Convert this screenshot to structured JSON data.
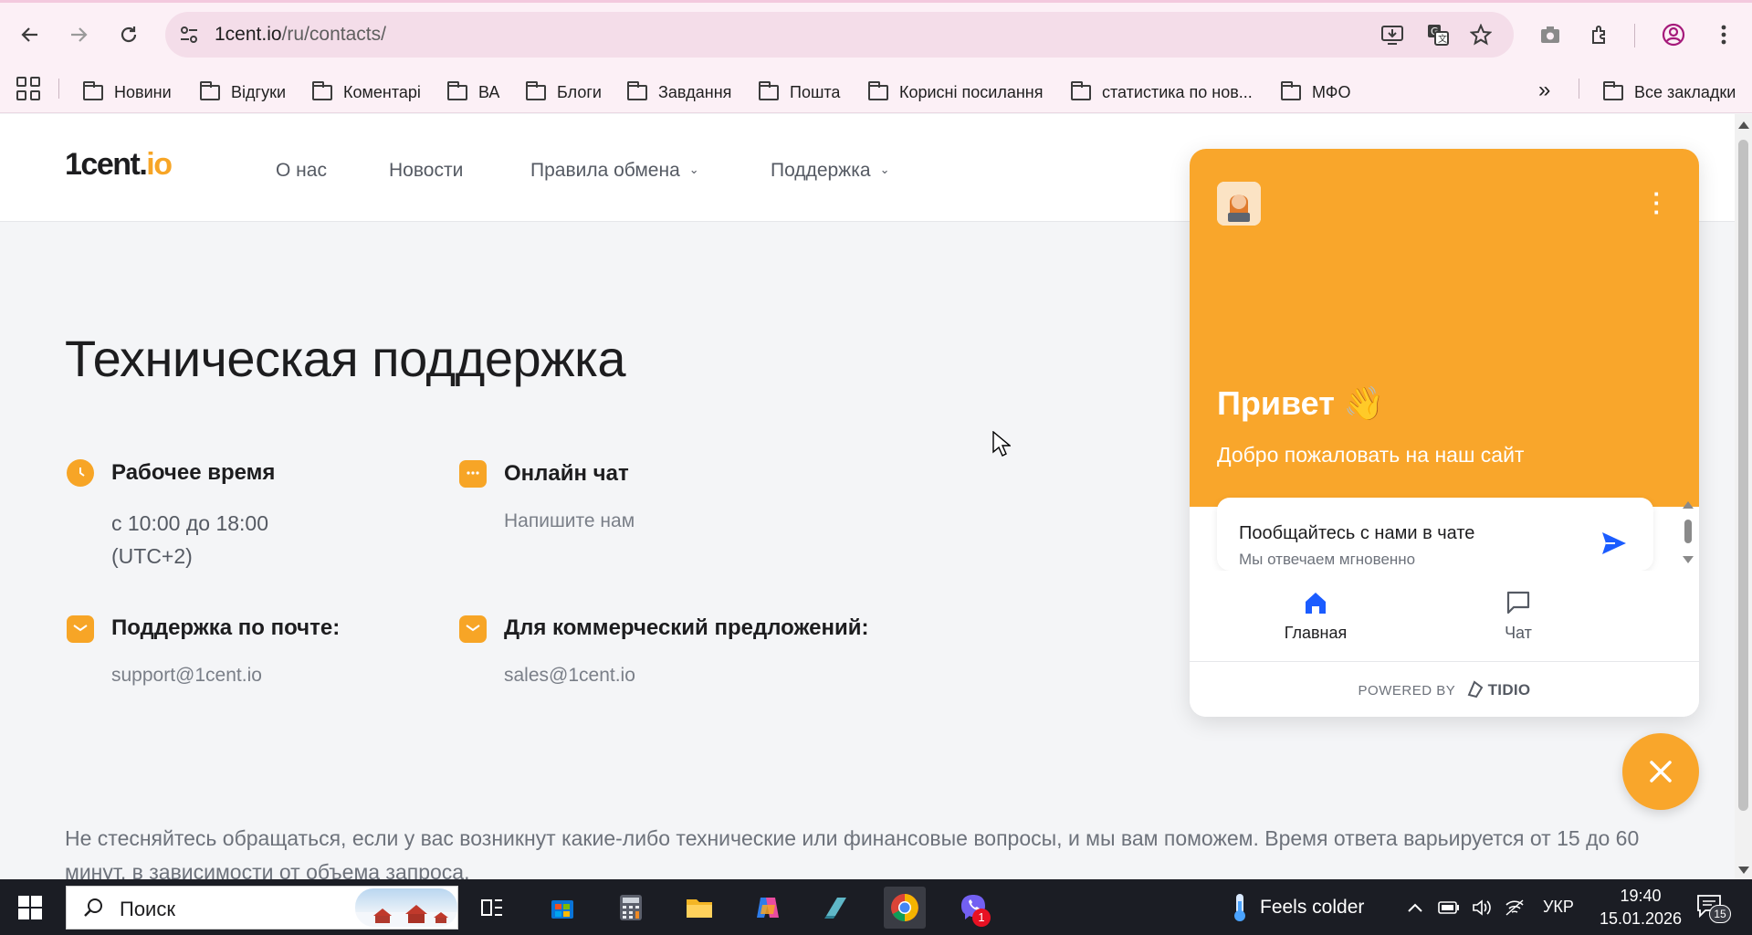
{
  "browser": {
    "url_domain": "1cent.io",
    "url_path": "/ru/contacts/",
    "bookmarks": [
      "Новини",
      "Відгуки",
      "Коментарі",
      "ВА",
      "Блоги",
      "Завдання",
      "Пошта",
      "Корисні посилання",
      "статистика по нов...",
      "МФО"
    ],
    "all_bookmarks": "Все закладки",
    "more_bookmarks_glyph": "»"
  },
  "site": {
    "logo_main": "1cent.",
    "logo_accent": "io",
    "nav": {
      "about": "О нас",
      "news": "Новости",
      "exchange_rules": "Правила обмена",
      "support": "Поддержка"
    },
    "page_title": "Техническая поддержка",
    "working_hours": {
      "label": "Рабочее время",
      "value_line1": "с 10:00 до 18:00",
      "value_line2": "(UTC+2)"
    },
    "online_chat": {
      "label": "Онлайн чат",
      "value": "Напишите нам"
    },
    "email_support": {
      "label": "Поддержка по почте:",
      "value": "support@1cent.io"
    },
    "commercial": {
      "label": "Для коммерческий предложений:",
      "value": "sales@1cent.io"
    },
    "footer_text": "Не стесняйтесь обращаться, если у вас возникнут какие-либо технические или финансовые вопросы, и мы вам поможем. Время ответа варьируется от 15 до 60 минут, в зависимости от объема запроса."
  },
  "chat": {
    "greeting": "Привет 👋",
    "welcome": "Добро пожаловать на наш сайт",
    "card_title": "Пообщайтесь с нами в чате",
    "card_sub": "Мы отвечаем мгновенно",
    "tab_home": "Главная",
    "tab_chat": "Чат",
    "powered_by": "POWERED BY",
    "powered_brand": "TIDIO"
  },
  "taskbar": {
    "search_placeholder": "Поиск",
    "weather": "Feels colder",
    "language": "УКР",
    "time": "19:40",
    "date": "15.01.2026",
    "viber_badge": "1",
    "notifications": "15"
  },
  "colors": {
    "accent": "#f7a526",
    "chat_header": "#f9a62b",
    "send_blue": "#1b5cff"
  }
}
